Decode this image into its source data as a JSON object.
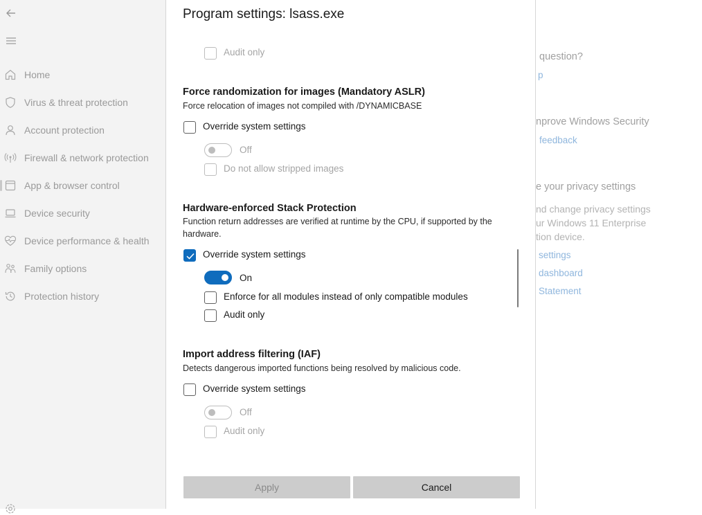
{
  "nav": {
    "items": [
      {
        "label": "Home",
        "icon": "home-icon"
      },
      {
        "label": "Virus & threat protection",
        "icon": "shield-icon"
      },
      {
        "label": "Account protection",
        "icon": "person-icon"
      },
      {
        "label": "Firewall & network protection",
        "icon": "wireless-icon"
      },
      {
        "label": "App & browser control",
        "icon": "app-window-icon"
      },
      {
        "label": "Device security",
        "icon": "laptop-icon"
      },
      {
        "label": "Device performance & health",
        "icon": "heart-pulse-icon"
      },
      {
        "label": "Family options",
        "icon": "family-icon"
      },
      {
        "label": "Protection history",
        "icon": "history-icon"
      }
    ]
  },
  "background": {
    "question_heading": "question?",
    "help_link": "p",
    "improve_heading": "nprove Windows Security",
    "feedback_link": "feedback",
    "privacy_heading": "e your privacy settings",
    "privacy_text_1": "nd change privacy settings",
    "privacy_text_2": "ur Windows 11 Enterprise",
    "privacy_text_3": "tion device.",
    "privacy_settings_link": "settings",
    "dashboard_link": "dashboard",
    "statement_link": "Statement"
  },
  "dialog": {
    "title": "Program settings: lsass.exe",
    "top_audit_label": "Audit only",
    "aslr": {
      "title": "Force randomization for images (Mandatory ASLR)",
      "description": "Force relocation of images not compiled with /DYNAMICBASE",
      "override_label": "Override system settings",
      "toggle_label": "Off",
      "stripped_label": "Do not allow stripped images"
    },
    "stack": {
      "title": "Hardware-enforced Stack Protection",
      "description": "Function return addresses are verified at runtime by the CPU, if supported by the hardware.",
      "override_label": "Override system settings",
      "toggle_label": "On",
      "enforce_label": "Enforce for all modules instead of only compatible modules",
      "audit_label": "Audit only"
    },
    "iaf": {
      "title": "Import address filtering (IAF)",
      "description": "Detects dangerous imported functions being resolved by malicious code.",
      "override_label": "Override system settings",
      "toggle_label": "Off",
      "audit_label": "Audit only"
    },
    "apply_label": "Apply",
    "cancel_label": "Cancel"
  },
  "colors": {
    "accent": "#0f6cbd",
    "nav_background": "#f3f3f3",
    "link": "#8fb6dd"
  }
}
